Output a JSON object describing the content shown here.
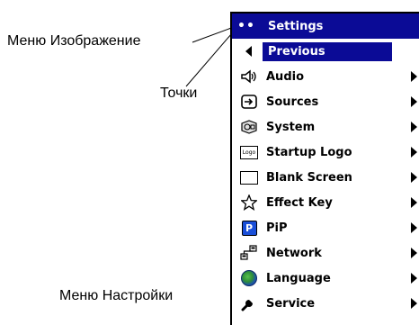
{
  "callouts": {
    "image_menu": "Меню Изображение",
    "dots": "Точки",
    "settings_menu": "Меню Настройки"
  },
  "menu": {
    "header": {
      "dots": "••",
      "title": "Settings"
    },
    "items": [
      {
        "label": "Previous",
        "icon": "left-arrow-icon",
        "selected": true,
        "submenu": false
      },
      {
        "label": "Audio",
        "icon": "speaker-icon",
        "submenu": true
      },
      {
        "label": "Sources",
        "icon": "source-input-icon",
        "submenu": true
      },
      {
        "label": "System",
        "icon": "system-icon",
        "submenu": true
      },
      {
        "label": "Startup Logo",
        "icon": "logo-icon",
        "icon_text": "Logo",
        "submenu": true
      },
      {
        "label": "Blank Screen",
        "icon": "blank-screen-icon",
        "submenu": true
      },
      {
        "label": "Effect Key",
        "icon": "star-icon",
        "submenu": true
      },
      {
        "label": "PiP",
        "icon": "pip-icon",
        "icon_text": "P",
        "submenu": true
      },
      {
        "label": "Network",
        "icon": "network-icon",
        "submenu": true
      },
      {
        "label": "Language",
        "icon": "globe-icon",
        "submenu": true
      },
      {
        "label": "Service",
        "icon": "wrench-icon",
        "submenu": true
      }
    ]
  },
  "colors": {
    "accent": "#0b0b96",
    "pip": "#1a4fd8"
  }
}
